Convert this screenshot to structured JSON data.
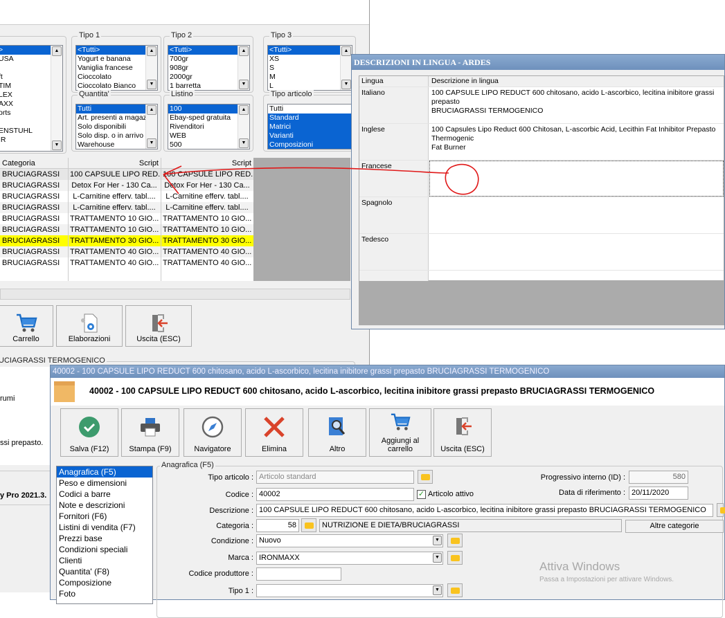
{
  "filters": {
    "partial_list": [
      ">",
      " USA",
      "",
      "ft",
      "TIM",
      "LEX",
      "AXX",
      "orts",
      "",
      "ENSTUHL",
      "IR"
    ],
    "tipo1": {
      "title": "Tipo 1",
      "items": [
        "<Tutti>",
        "Yogurt e banana",
        "Vaniglia francese",
        "Cioccolato",
        "Cioccolato Bianco"
      ]
    },
    "tipo2": {
      "title": "Tipo 2",
      "items": [
        "<Tutti>",
        "700gr",
        "908gr",
        "2000gr",
        "1 barretta"
      ]
    },
    "tipo3": {
      "title": "Tipo 3",
      "items": [
        "<Tutti>",
        "XS",
        "S",
        "M",
        "L"
      ]
    },
    "quantita": {
      "title": "Quantita'",
      "items": [
        "Tutti",
        "Art. presenti a magazzino",
        "Solo disponibili",
        "Solo disp. o in arrivo",
        "Warehouse"
      ]
    },
    "listino": {
      "title": "Listino",
      "items": [
        "100",
        "Ebay-sped gratuita",
        "Rivenditori",
        "WEB",
        "500"
      ]
    },
    "tipo_articolo": {
      "title": "Tipo articolo",
      "items": [
        "Tutti",
        "Standard",
        "Matrici",
        "Varianti",
        "Composizioni"
      ]
    }
  },
  "grid": {
    "headers": [
      "Categoria",
      "Script",
      "Script"
    ],
    "rows": [
      [
        "BRUCIAGRASSI",
        "100 CAPSULE LIPO RED...",
        "100 CAPSULE LIPO RED..."
      ],
      [
        "BRUCIAGRASSI",
        "Detox For Her - 130 Ca...",
        "Detox For Her - 130 Ca..."
      ],
      [
        "BRUCIAGRASSI",
        "L-Carnitine efferv. tabl....",
        "L-Carnitine efferv. tabl...."
      ],
      [
        "BRUCIAGRASSI",
        "L-Carnitine efferv. tabl....",
        "L-Carnitine efferv. tabl...."
      ],
      [
        "BRUCIAGRASSI",
        "TRATTAMENTO 10 GIO...",
        "TRATTAMENTO 10 GIO..."
      ],
      [
        "BRUCIAGRASSI",
        "TRATTAMENTO 10 GIO...",
        "TRATTAMENTO 10 GIO..."
      ],
      [
        "BRUCIAGRASSI",
        "TRATTAMENTO 30 GIO...",
        "TRATTAMENTO 30 GIO..."
      ],
      [
        "BRUCIAGRASSI",
        "TRATTAMENTO 40 GIO...",
        "TRATTAMENTO 40 GIO..."
      ],
      [
        "BRUCIAGRASSI",
        "TRATTAMENTO 40 GIO...",
        "TRATTAMENTO 40 GIO..."
      ]
    ],
    "highlight_color": "#ffff00"
  },
  "bg_toolbar": {
    "carrello": "Carrello",
    "elaborazioni": "Elaborazioni",
    "uscita": "Uscita (ESC)"
  },
  "bg_group_label": "UCIAGRASSI TERMOGENICO",
  "bg_text": {
    "line1": "rumi",
    "line2": "ssi prepasto.",
    "status": "y Pro 2021.3."
  },
  "lang_dialog": {
    "title": "DESCRIZIONI IN LINGUA - ARDES",
    "headers": [
      "Lingua",
      "Descrizione in lingua"
    ],
    "rows": [
      {
        "lang": "Italiano",
        "text": "100 CAPSULE LIPO REDUCT 600   chitosano, acido L-ascorbico, lecitina inibitore grassi prepasto",
        "text2": "BRUCIAGRASSI TERMOGENICO"
      },
      {
        "lang": "Inglese",
        "text": "100 Capsules Lipo Reduct 600 Chitosan, L-ascorbic Acid, Lecithin Fat Inhibitor Prepasto Thermogenic",
        "text2": "Fat Burner"
      },
      {
        "lang": "Francese",
        "text": "",
        "text2": ""
      },
      {
        "lang": "Spagnolo",
        "text": "",
        "text2": ""
      },
      {
        "lang": "Tedesco",
        "text": "",
        "text2": ""
      }
    ]
  },
  "article": {
    "window_title": "40002 - 100 CAPSULE LIPO REDUCT 600   chitosano, acido L-ascorbico, lecitina inibitore grassi prepasto BRUCIAGRASSI TERMOGENICO",
    "header_title": "40002 - 100 CAPSULE LIPO REDUCT 600   chitosano, acido L-ascorbico, lecitina inibitore grassi prepasto BRUCIAGRASSI TERMOGENICO",
    "toolbar": {
      "salva": "Salva (F12)",
      "stampa": "Stampa (F9)",
      "navigatore": "Navigatore",
      "elimina": "Elimina",
      "altro": "Altro",
      "aggiungi1": "Aggiungi al",
      "aggiungi2": "carrello",
      "uscita": "Uscita (ESC)"
    },
    "nav": [
      "Anagrafica (F5)",
      "Peso e dimensioni",
      "Codici a barre",
      "Note e descrizioni",
      "Fornitori (F6)",
      "Listini di vendita (F7)",
      "Prezzi base",
      "Condizioni speciali",
      "Clienti",
      "Quantita' (F8)",
      "Composizione",
      "Foto"
    ],
    "group_label": "Anagrafica (F5)",
    "fields": {
      "tipo_articolo_label": "Tipo articolo :",
      "tipo_articolo": "Articolo standard",
      "codice_label": "Codice :",
      "codice": "40002",
      "attivo_label": "Articolo attivo",
      "attivo": true,
      "descrizione_label": "Descrizione :",
      "descrizione": "100 CAPSULE LIPO REDUCT 600   chitosano, acido L-ascorbico, lecitina inibitore grassi prepasto BRUCIAGRASSI TERMOGENICO",
      "categoria_label": "Categoria :",
      "categoria_id": "58",
      "categoria_nome": "NUTRIZIONE E DIETA/BRUCIAGRASSI",
      "altre_categorie": "Altre categorie",
      "condizione_label": "Condizione :",
      "condizione": "Nuovo",
      "marca_label": "Marca :",
      "marca": "IRONMAXX",
      "codice_produttore_label": "Codice produttore :",
      "codice_produttore": "",
      "tipo1_label": "Tipo 1 :",
      "tipo1": "",
      "progressivo_label": "Progressivo interno (ID) :",
      "progressivo": "580",
      "data_label": "Data di riferimento :",
      "data": "20/11/2020"
    }
  },
  "watermark": {
    "line1": "Attiva Windows",
    "line2": "Passa a Impostazioni per attivare Windows."
  }
}
